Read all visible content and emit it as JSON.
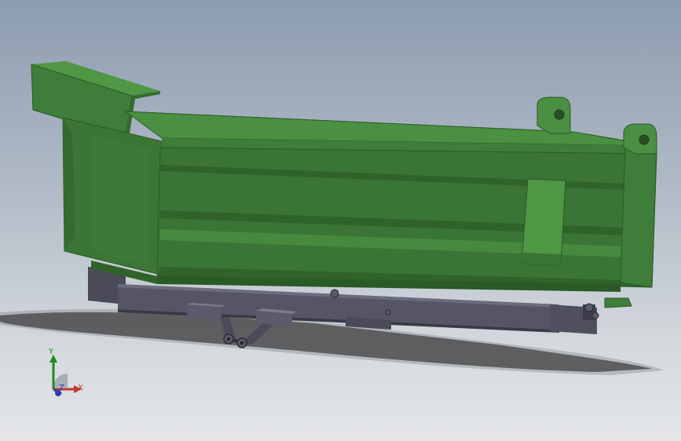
{
  "viewport": {
    "title": "",
    "background_top": "#8d9cb0",
    "background_bottom": "#e4e6e8"
  },
  "model": {
    "part": "dump-truck-body",
    "body_color": "#3f7d3a",
    "body_dark_color": "#2f6329",
    "body_light_color": "#4f9645",
    "frame_color": "#4d4d5c",
    "shadow_color": "#3a3a3a"
  },
  "triad": {
    "x_label": "X",
    "y_label": "Y",
    "z_label": "Z",
    "x_color": "#c0392b",
    "y_color": "#1e8a1e",
    "z_color": "#2a3ea8"
  }
}
